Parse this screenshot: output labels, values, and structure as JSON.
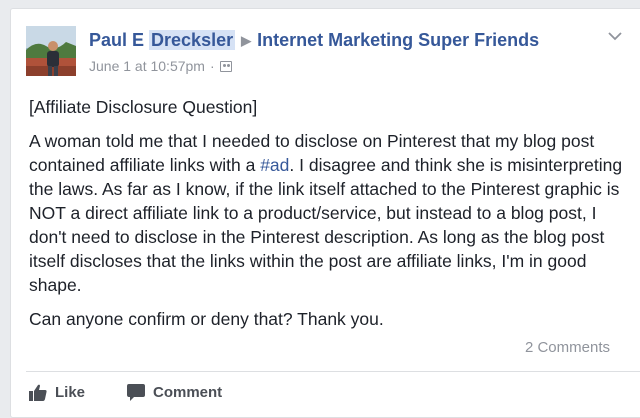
{
  "post": {
    "author": "Paul E Drecksler",
    "author_first": "Paul E ",
    "author_last": "Drecksler",
    "separator_icon": "triangle-right-icon",
    "group": "Internet Marketing Super Friends",
    "timestamp": "June 1 at 10:57pm",
    "dot": "·",
    "audience_icon": "group-audience-icon",
    "options_icon": "chevron-down-icon",
    "paragraphs": {
      "title": "[Affiliate Disclosure Question]",
      "p2_before": "A woman told me that I needed to disclose on Pinterest that my blog post contained affiliate links with a ",
      "p2_hashtag": "#ad",
      "p2_after": ". I disagree and think she is misinterpreting the laws. As far as I know, if the link itself attached to the Pinterest graphic is NOT a direct affiliate link to a product/service, but instead to a blog post, I don't need to disclose in the Pinterest description. As long as the blog post itself discloses that the links within the post are affiliate links, I'm in good shape.",
      "p3": "Can anyone confirm or deny that? Thank you."
    },
    "comments_count": "2 Comments"
  },
  "actions": {
    "like_label": "Like",
    "comment_label": "Comment"
  },
  "colors": {
    "link": "#365899",
    "meta": "#90949c",
    "text": "#1d2129",
    "background": "#e9ebee",
    "card": "#ffffff"
  }
}
